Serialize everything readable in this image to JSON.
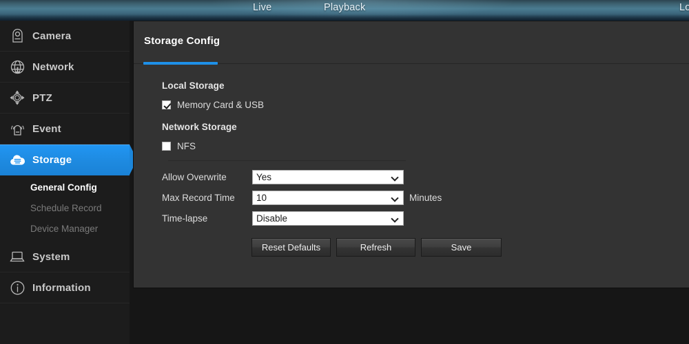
{
  "topbar": {
    "items": [
      {
        "name": "live",
        "label": "Live"
      },
      {
        "name": "playback",
        "label": "Playback"
      },
      {
        "name": "logout",
        "label": "Lo"
      }
    ]
  },
  "sidebar": {
    "items": [
      {
        "label": "Camera",
        "icon": "camera-icon",
        "active": false
      },
      {
        "label": "Network",
        "icon": "network-globe-icon",
        "active": false
      },
      {
        "label": "PTZ",
        "icon": "ptz-directional-icon",
        "active": false
      },
      {
        "label": "Event",
        "icon": "alarm-bell-icon",
        "active": false
      },
      {
        "label": "Storage",
        "icon": "storage-cloud-icon",
        "active": true
      },
      {
        "label": "System",
        "icon": "laptop-icon",
        "active": false
      },
      {
        "label": "Information",
        "icon": "info-circle-icon",
        "active": false
      }
    ],
    "submenu": [
      {
        "label": "General Config",
        "active": true
      },
      {
        "label": "Schedule Record",
        "active": false
      },
      {
        "label": "Device Manager",
        "active": false
      }
    ]
  },
  "panel": {
    "title": "Storage Config",
    "local_storage_label": "Local Storage",
    "network_storage_label": "Network Storage",
    "checkboxes": [
      {
        "name": "memory-card-usb",
        "label": "Memory Card & USB",
        "checked": true
      },
      {
        "name": "nfs",
        "label": "NFS",
        "checked": false
      }
    ],
    "fields": [
      {
        "name": "allow-overwrite",
        "label": "Allow Overwrite",
        "value": "Yes",
        "suffix": ""
      },
      {
        "name": "max-record-time",
        "label": "Max Record Time",
        "value": "10",
        "suffix": "Minutes"
      },
      {
        "name": "time-lapse",
        "label": "Time-lapse",
        "value": "Disable",
        "suffix": ""
      }
    ],
    "buttons": [
      {
        "name": "reset-defaults",
        "label": "Reset Defaults"
      },
      {
        "name": "refresh",
        "label": "Refresh"
      },
      {
        "name": "save",
        "label": "Save"
      }
    ]
  },
  "colors": {
    "accent": "#1e90e8",
    "active_sidebar": "#2196f3",
    "sidebar_bg": "#1c1c1c",
    "content_bg": "#333333",
    "page_bg": "#161616"
  }
}
